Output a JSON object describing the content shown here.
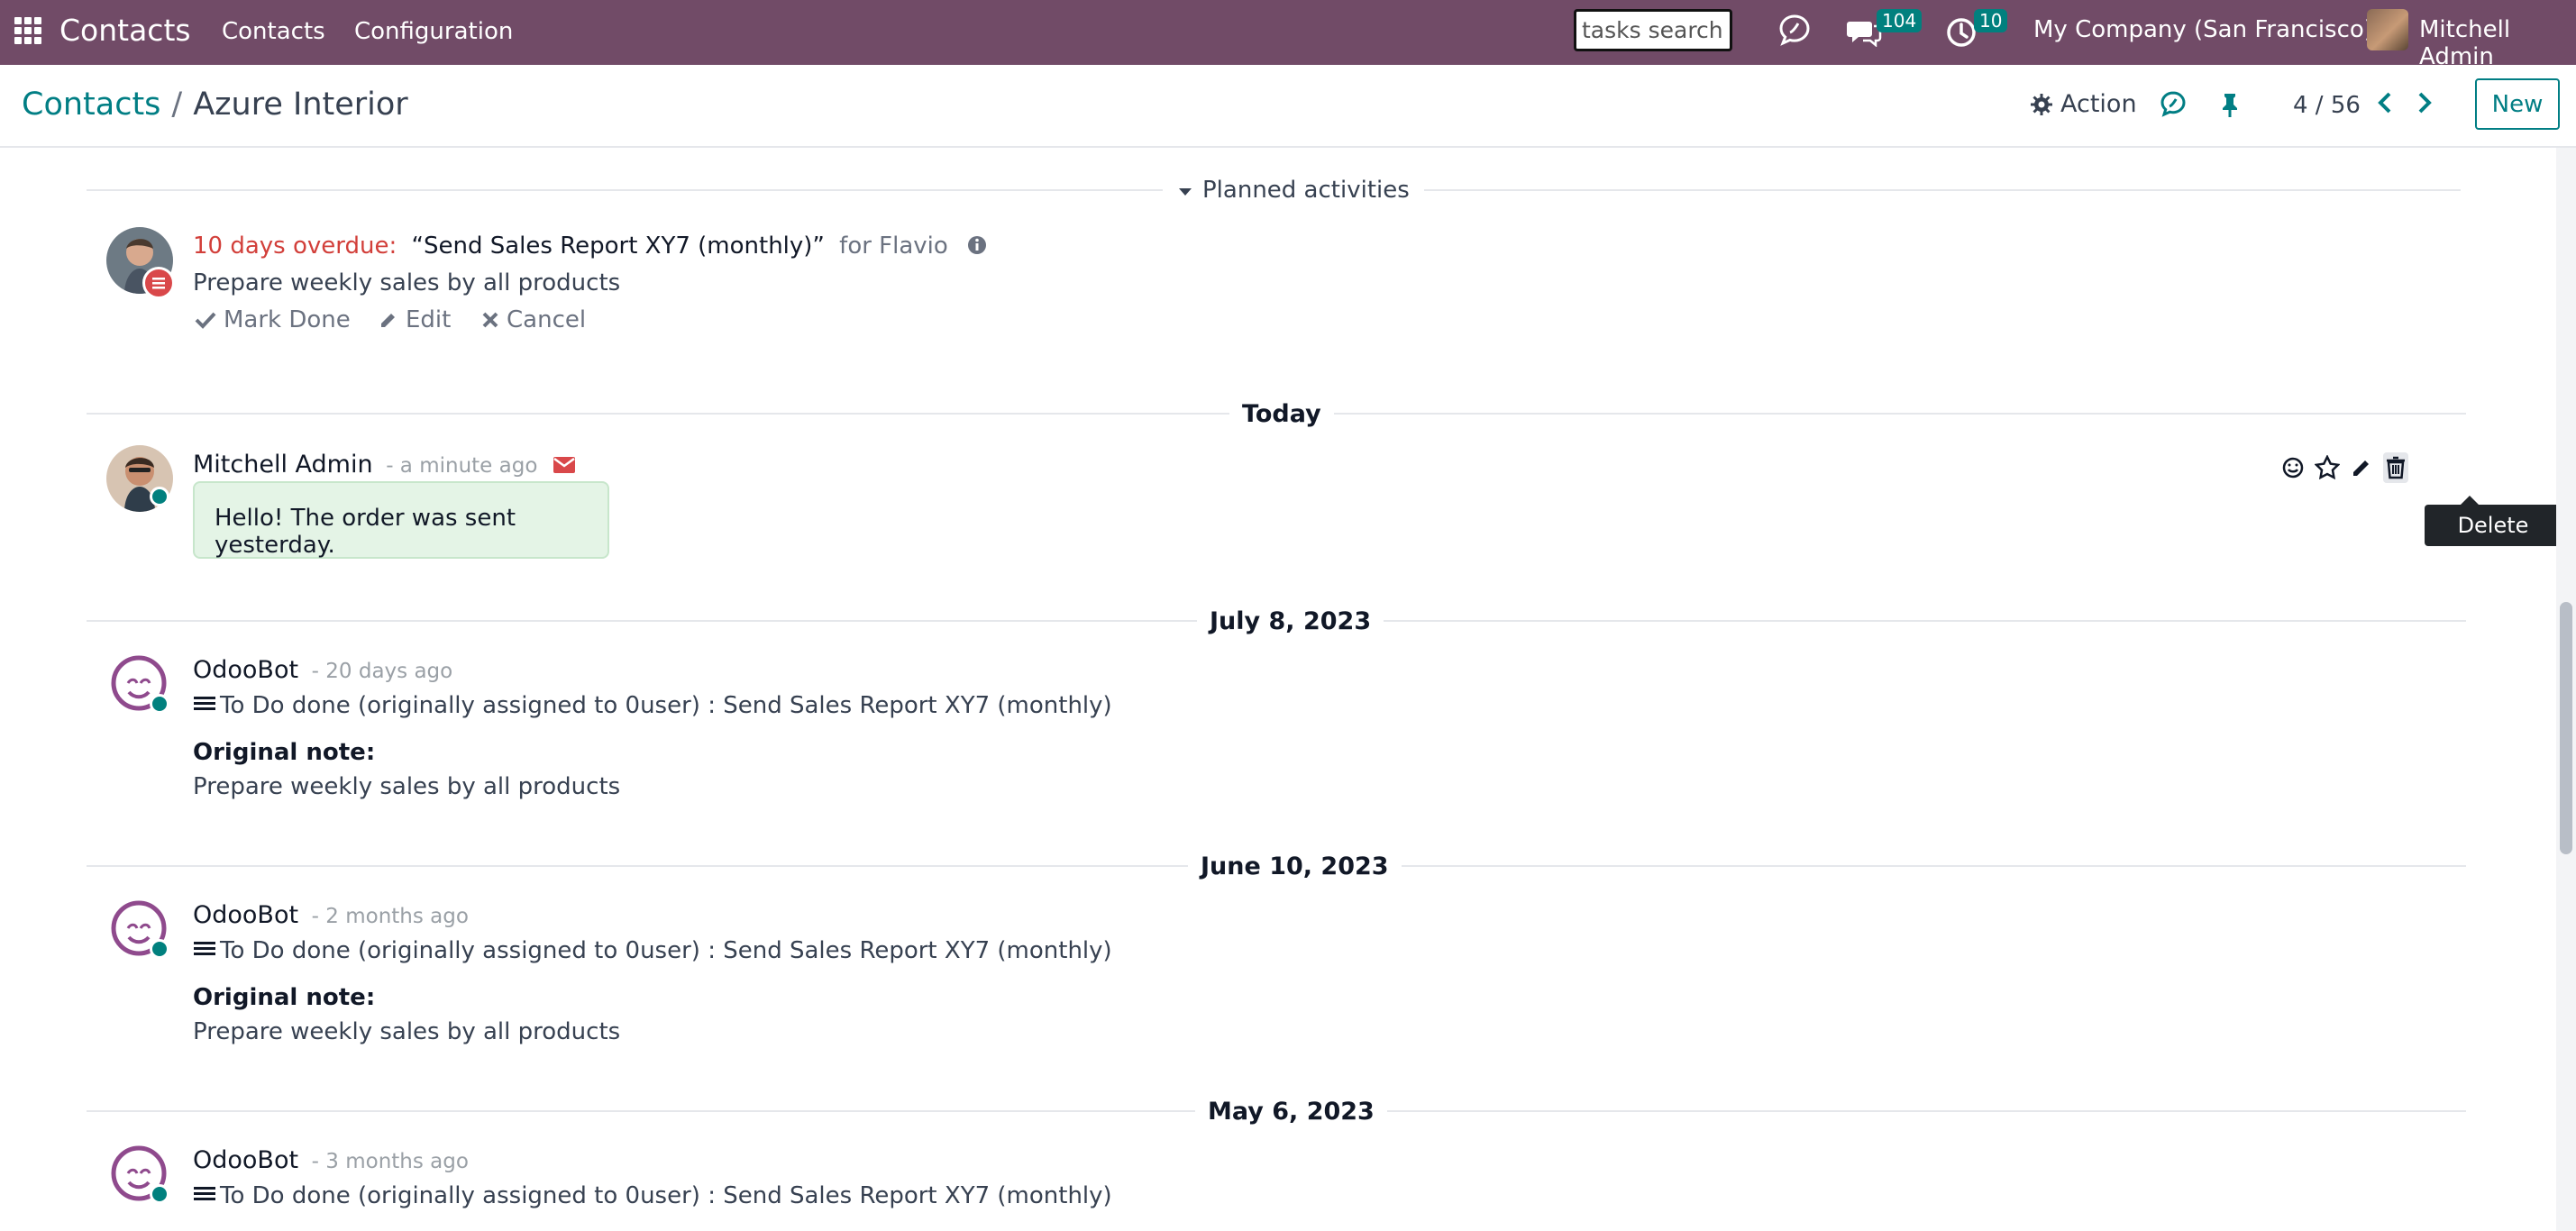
{
  "navbar": {
    "brand": "Contacts",
    "menu": [
      "Contacts",
      "Configuration"
    ],
    "search_value": "tasks search",
    "messages_count": "104",
    "activities_count": "10",
    "company": "My Company (San Francisco)",
    "user": "Mitchell Admin"
  },
  "control_panel": {
    "breadcrumb_root": "Contacts",
    "breadcrumb_current": "Azure Interior",
    "action_label": "Action",
    "pager": "4 / 56",
    "new_label": "New"
  },
  "planned": {
    "title": "Planned activities",
    "overdue": "10 days overdue:",
    "summary": "“Send Sales Report XY7 (monthly)”",
    "for_text": "for Flavio",
    "note": "Prepare weekly sales by all products",
    "mark_done": "Mark Done",
    "edit": "Edit",
    "cancel": "Cancel"
  },
  "messages": [
    {
      "date": "Today",
      "author": "Mitchell Admin",
      "time": "- a minute ago",
      "body": "Hello! The order was sent yesterday.",
      "tooltip": "Delete"
    },
    {
      "date": "July 8, 2023",
      "author": "OdooBot",
      "time": "- 20 days ago",
      "body": "To Do done (originally assigned to 0user) : Send Sales Report XY7 (monthly)",
      "note_label": "Original note:",
      "note": "Prepare weekly sales by all products"
    },
    {
      "date": "June 10, 2023",
      "author": "OdooBot",
      "time": "- 2 months ago",
      "body": "To Do done (originally assigned to 0user) : Send Sales Report XY7 (monthly)",
      "note_label": "Original note:",
      "note": "Prepare weekly sales by all products"
    },
    {
      "date": "May 6, 2023",
      "author": "OdooBot",
      "time": "- 3 months ago",
      "body": "To Do done (originally assigned to 0user) : Send Sales Report XY7 (monthly)"
    }
  ],
  "colors": {
    "navbar": "#714b67",
    "accent": "#017e84",
    "overdue": "#d23f3a",
    "message_bg": "#e4f4e6"
  },
  "icons": [
    "apps-icon",
    "discuss-icon",
    "chat-icon",
    "clock-icon",
    "gear-icon",
    "refresh-icon",
    "pin-icon",
    "chevron-left-icon",
    "chevron-right-icon",
    "caret-down-icon",
    "info-icon",
    "check-icon",
    "pencil-icon",
    "close-icon",
    "envelope-icon",
    "smile-icon",
    "star-icon",
    "trash-icon",
    "todo-icon"
  ]
}
